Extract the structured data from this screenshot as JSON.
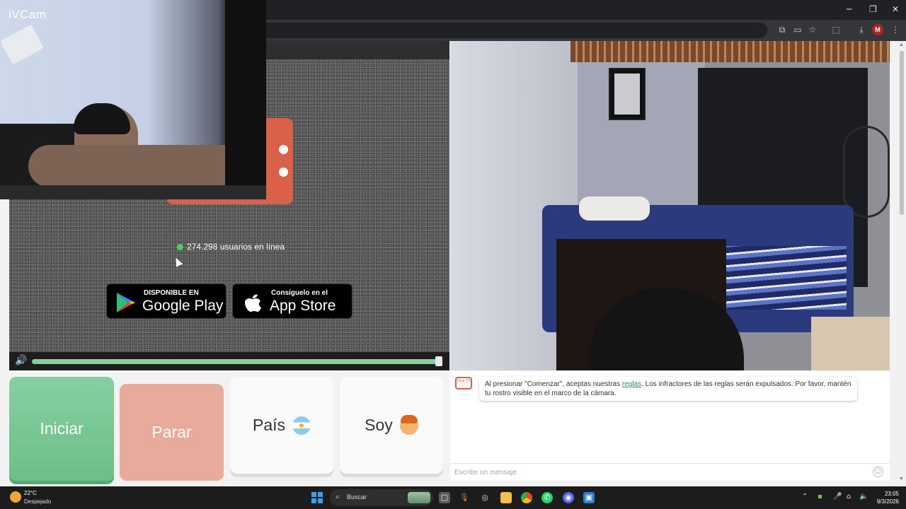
{
  "overlay": {
    "brand": "iVCam"
  },
  "window": {
    "minimize": "─",
    "maximize": "❐",
    "close": "✕"
  },
  "toolbar": {
    "profile_initial": "M"
  },
  "page": {
    "online_text": "274.298 usuarios en línea",
    "google_play": {
      "small": "DISPONIBLE EN",
      "big": "Google Play"
    },
    "app_store": {
      "small": "Consíguelo en el",
      "big": "App Store"
    },
    "volume_level": 1.0
  },
  "buttons": {
    "start": "Iniciar",
    "stop": "Parar",
    "country": "País",
    "soy": "Soy"
  },
  "chat": {
    "logo_text": "Ome TV",
    "message_before": "Al presionar \"Comenzar\", aceptas nuestras ",
    "message_link": "reglas",
    "message_after": ". Los infractores de las reglas serán expulsados. Por favor, mantén tu rostro visible en el marco de la cámara.",
    "input_placeholder": "Escribe un mensaje"
  },
  "taskbar": {
    "weather_temp": "22°C",
    "weather_desc": "Despejado",
    "search_placeholder": "Buscar",
    "time": "23:05",
    "date": "9/3/2026",
    "apps": [
      "file-explorer-icon",
      "microphone-icon",
      "recording-icon",
      "folder-icon",
      "chrome-icon",
      "whatsapp-icon",
      "discord-icon",
      "app-icon"
    ]
  },
  "colors": {
    "start_button": "#7cc796",
    "stop_button": "#e8aa9b",
    "online_dot": "#46d160",
    "brand_red": "#d9614a"
  }
}
